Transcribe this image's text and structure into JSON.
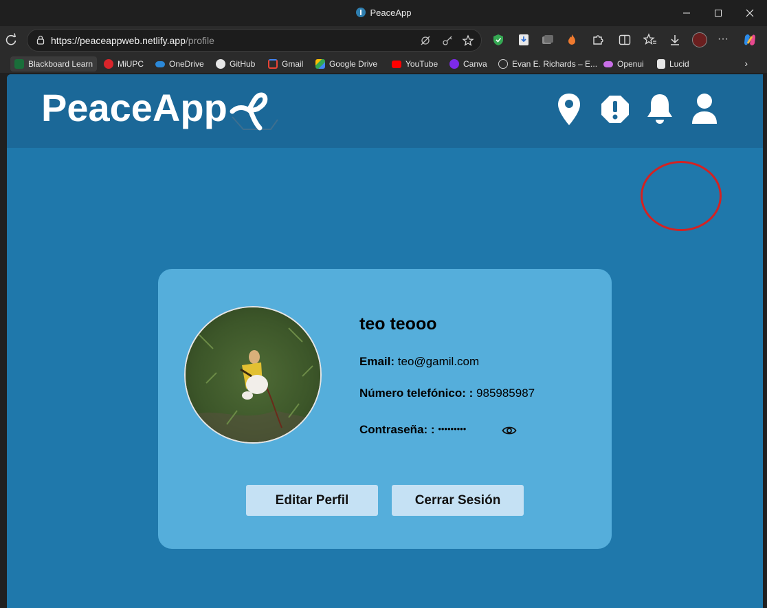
{
  "window": {
    "title": "PeaceApp",
    "controls": [
      "minimize",
      "maximize",
      "close"
    ]
  },
  "browser": {
    "url_host": "https://peaceappweb.netlify.app",
    "url_path": "/profile",
    "bookmarks": [
      {
        "label": "Blackboard Learn",
        "color": "#1a6e3a"
      },
      {
        "label": "MiUPC",
        "color": "#d9242a"
      },
      {
        "label": "OneDrive",
        "color": "#2b88d8"
      },
      {
        "label": "GitHub",
        "color": "#e6e6e6"
      },
      {
        "label": "Gmail",
        "color": "#ea4335"
      },
      {
        "label": "Google Drive",
        "color": "#34a853"
      },
      {
        "label": "YouTube",
        "color": "#ff0000"
      },
      {
        "label": "Canva",
        "color": "#7d2ae8"
      },
      {
        "label": "Evan E. Richards – E...",
        "color": "#cfcfcf"
      },
      {
        "label": "Openui",
        "color": "#c86ee6"
      },
      {
        "label": "Lucid",
        "color": "#e6e6e6"
      }
    ]
  },
  "app": {
    "logo_text": "PeaceApp",
    "header_icons": [
      "location-pin-icon",
      "alert-octagon-icon",
      "bell-icon",
      "user-icon"
    ],
    "colors": {
      "background": "#1f78ab",
      "header": "#1b6898",
      "card": "#55aedb",
      "button": "#c5e1f4"
    }
  },
  "profile": {
    "name": "teo teooo",
    "email_label": "Email:",
    "email_value": "teo@gamil.com",
    "phone_label": "Número telefónico: :",
    "phone_value": "985985987",
    "password_label": "Contraseña: :",
    "password_value": "•••••••••",
    "edit_button": "Editar Perfil",
    "logout_button": "Cerrar Sesión"
  }
}
